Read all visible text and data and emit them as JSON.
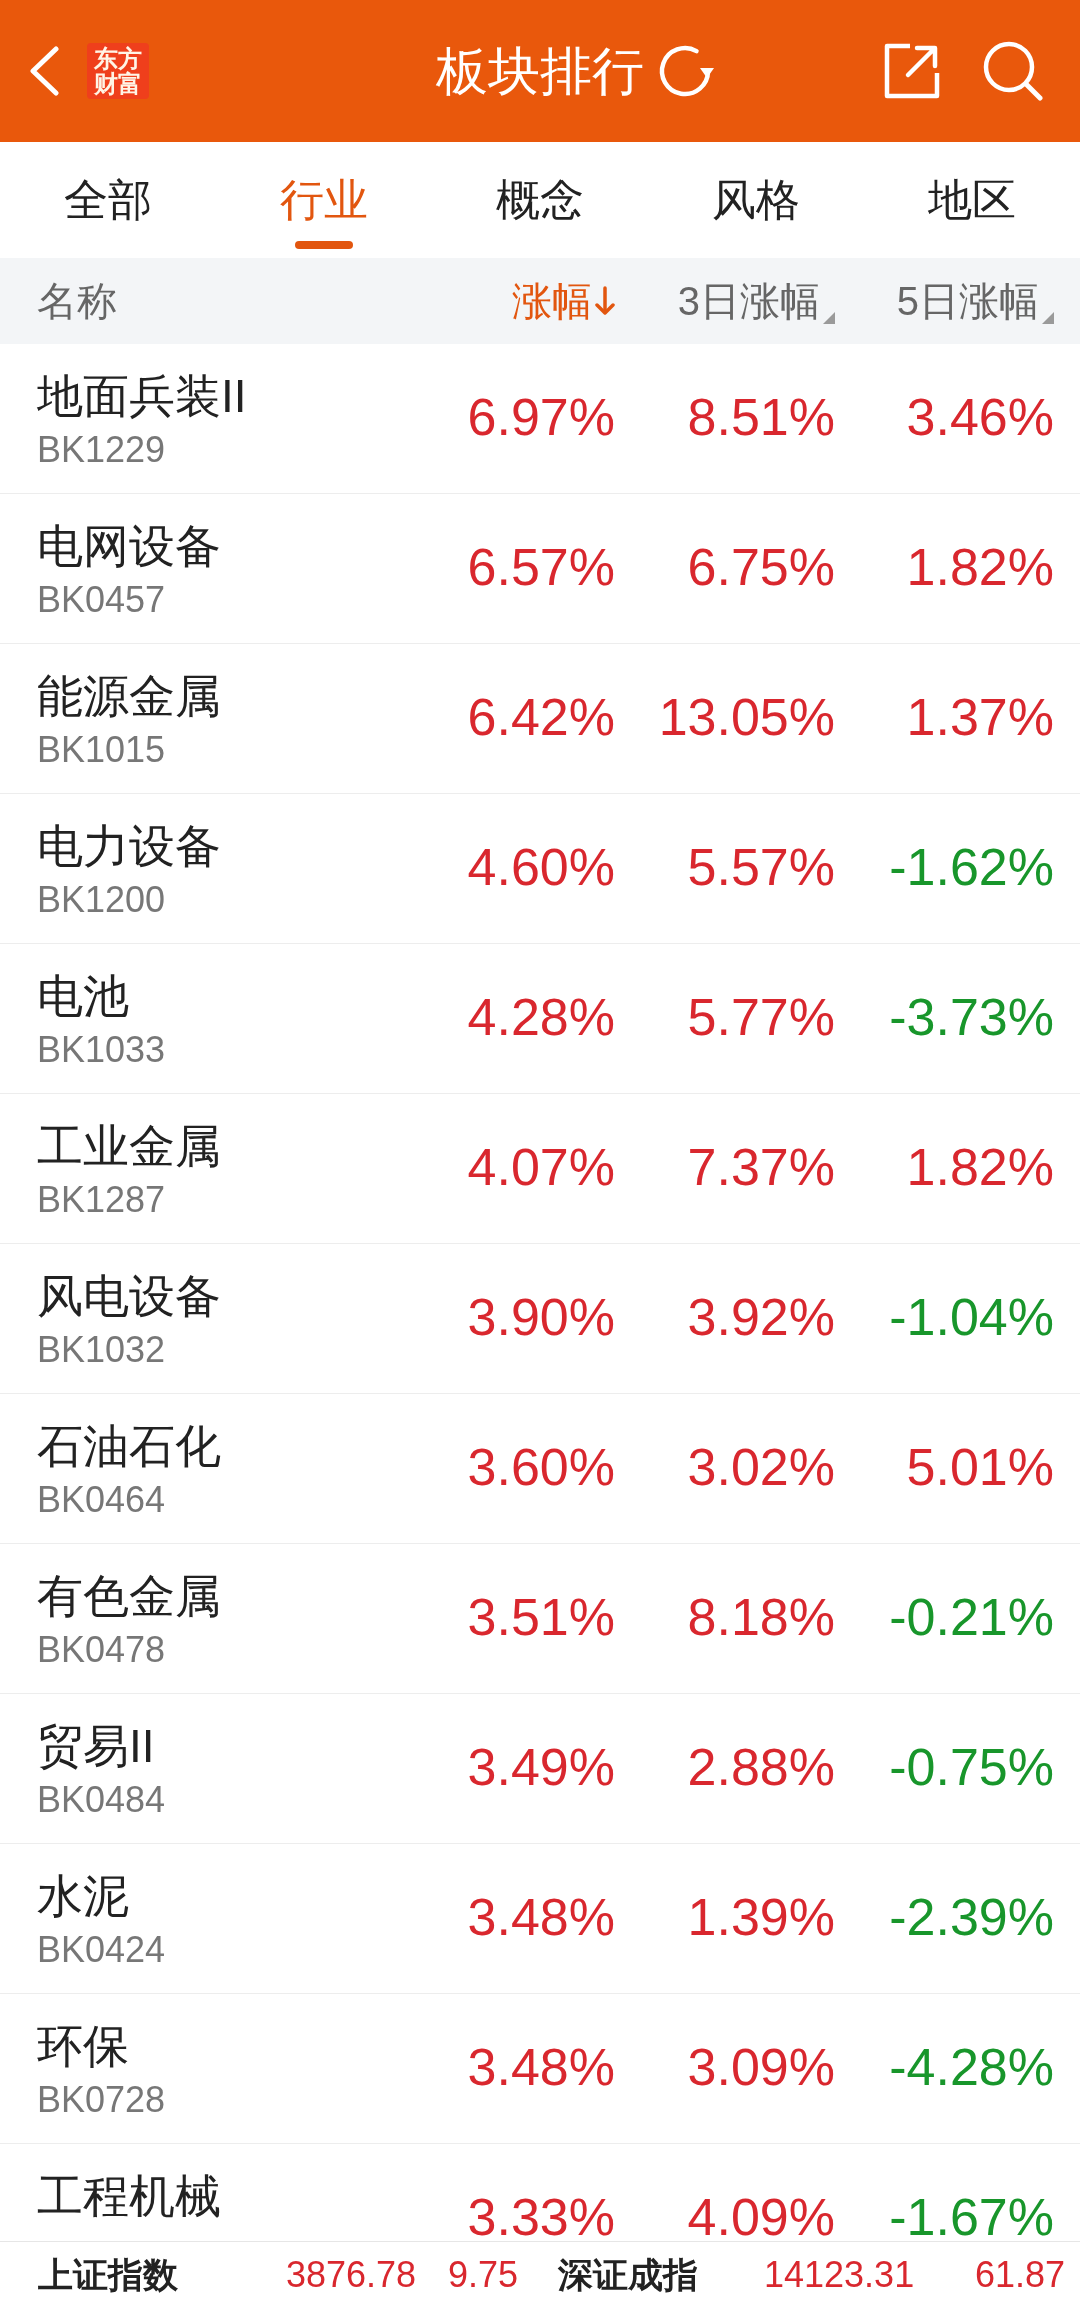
{
  "header": {
    "logo": "东方财富",
    "title": "板块排行"
  },
  "tabs": [
    {
      "label": "全部",
      "selected": false
    },
    {
      "label": "行业",
      "selected": true
    },
    {
      "label": "概念",
      "selected": false
    },
    {
      "label": "风格",
      "selected": false
    },
    {
      "label": "地区",
      "selected": false
    }
  ],
  "columns": {
    "name": "名称",
    "sort": [
      {
        "label": "涨幅",
        "selected": true
      },
      {
        "label": "3日涨幅",
        "selected": false
      },
      {
        "label": "5日涨幅",
        "selected": false
      }
    ]
  },
  "rows": [
    {
      "name": "地面兵装II",
      "code": "BK1229",
      "values": [
        {
          "text": "6.97%",
          "color": "#d9272e"
        },
        {
          "text": "8.51%",
          "color": "#d9272e"
        },
        {
          "text": "3.46%",
          "color": "#d9272e"
        }
      ]
    },
    {
      "name": "电网设备",
      "code": "BK0457",
      "values": [
        {
          "text": "6.57%",
          "color": "#d9272e"
        },
        {
          "text": "6.75%",
          "color": "#d9272e"
        },
        {
          "text": "1.82%",
          "color": "#d9272e"
        }
      ]
    },
    {
      "name": "能源金属",
      "code": "BK1015",
      "values": [
        {
          "text": "6.42%",
          "color": "#d9272e"
        },
        {
          "text": "13.05%",
          "color": "#d9272e"
        },
        {
          "text": "1.37%",
          "color": "#d9272e"
        }
      ]
    },
    {
      "name": "电力设备",
      "code": "BK1200",
      "values": [
        {
          "text": "4.60%",
          "color": "#d9272e"
        },
        {
          "text": "5.57%",
          "color": "#d9272e"
        },
        {
          "text": "-1.62%",
          "color": "#18962b"
        }
      ]
    },
    {
      "name": "电池",
      "code": "BK1033",
      "values": [
        {
          "text": "4.28%",
          "color": "#d9272e"
        },
        {
          "text": "5.77%",
          "color": "#d9272e"
        },
        {
          "text": "-3.73%",
          "color": "#18962b"
        }
      ]
    },
    {
      "name": "工业金属",
      "code": "BK1287",
      "values": [
        {
          "text": "4.07%",
          "color": "#d9272e"
        },
        {
          "text": "7.37%",
          "color": "#d9272e"
        },
        {
          "text": "1.82%",
          "color": "#d9272e"
        }
      ]
    },
    {
      "name": "风电设备",
      "code": "BK1032",
      "values": [
        {
          "text": "3.90%",
          "color": "#d9272e"
        },
        {
          "text": "3.92%",
          "color": "#d9272e"
        },
        {
          "text": "-1.04%",
          "color": "#18962b"
        }
      ]
    },
    {
      "name": "石油石化",
      "code": "BK0464",
      "values": [
        {
          "text": "3.60%",
          "color": "#d9272e"
        },
        {
          "text": "3.02%",
          "color": "#d9272e"
        },
        {
          "text": "5.01%",
          "color": "#d9272e"
        }
      ]
    },
    {
      "name": "有色金属",
      "code": "BK0478",
      "values": [
        {
          "text": "3.51%",
          "color": "#d9272e"
        },
        {
          "text": "8.18%",
          "color": "#d9272e"
        },
        {
          "text": "-0.21%",
          "color": "#18962b"
        }
      ]
    },
    {
      "name": "贸易II",
      "code": "BK0484",
      "values": [
        {
          "text": "3.49%",
          "color": "#d9272e"
        },
        {
          "text": "2.88%",
          "color": "#d9272e"
        },
        {
          "text": "-0.75%",
          "color": "#18962b"
        }
      ]
    },
    {
      "name": "水泥",
      "code": "BK0424",
      "values": [
        {
          "text": "3.48%",
          "color": "#d9272e"
        },
        {
          "text": "1.39%",
          "color": "#d9272e"
        },
        {
          "text": "-2.39%",
          "color": "#18962b"
        }
      ]
    },
    {
      "name": "环保",
      "code": "BK0728",
      "values": [
        {
          "text": "3.48%",
          "color": "#d9272e"
        },
        {
          "text": "3.09%",
          "color": "#d9272e"
        },
        {
          "text": "-4.28%",
          "color": "#18962b"
        }
      ]
    },
    {
      "name": "工程机械",
      "values": [
        {
          "text": "3.33%",
          "color": "#d9272e"
        },
        {
          "text": "4.09%",
          "color": "#d9272e"
        },
        {
          "text": "-1.67%",
          "color": "#18962b"
        }
      ]
    }
  ],
  "index_bar": [
    {
      "name": "上证指数",
      "value": "3876.78",
      "change": "9.75",
      "color": "#d9272e"
    },
    {
      "name": "深证成指",
      "value": "14123.31",
      "change": "61.87",
      "color": "#d9272e"
    }
  ]
}
